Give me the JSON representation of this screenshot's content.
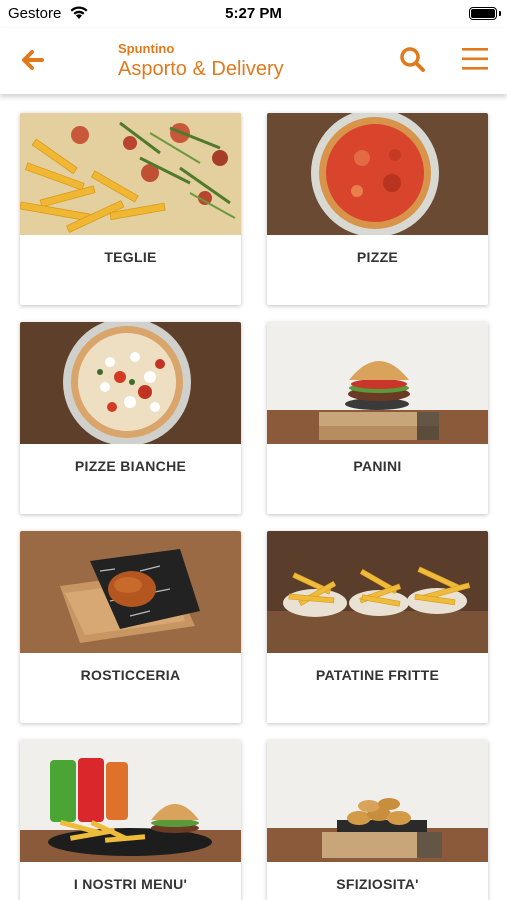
{
  "status_bar": {
    "carrier": "Gestore",
    "time": "5:27 PM"
  },
  "header": {
    "subtitle": "Spuntino",
    "title": "Asporto & Delivery",
    "back_icon": "arrow-left-icon",
    "search_icon": "search-icon",
    "menu_icon": "hamburger-menu-icon",
    "accent_color": "#e07a1d"
  },
  "categories": [
    {
      "label": "TEGLIE"
    },
    {
      "label": "PIZZE"
    },
    {
      "label": "PIZZE BIANCHE"
    },
    {
      "label": "PANINI"
    },
    {
      "label": "ROSTICCERIA"
    },
    {
      "label": "PATATINE FRITTE"
    },
    {
      "label": "I NOSTRI MENU'"
    },
    {
      "label": "SFIZIOSITA'"
    }
  ]
}
